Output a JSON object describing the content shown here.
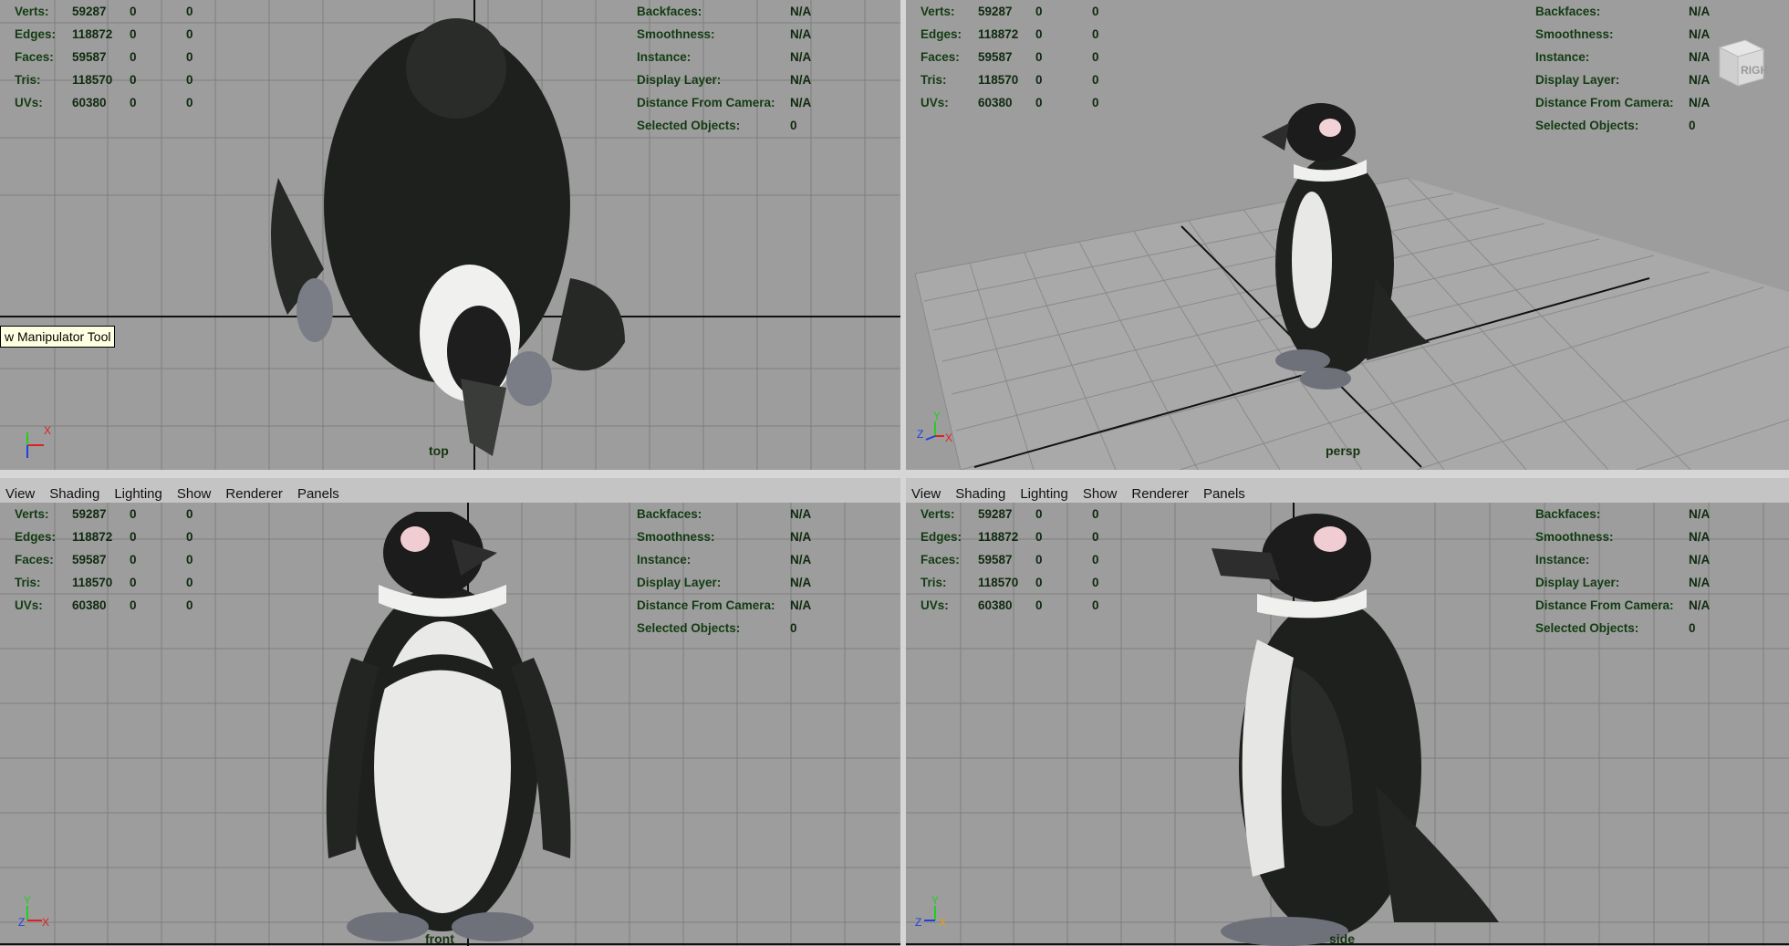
{
  "hud": {
    "left_labels": [
      "Verts:",
      "Edges:",
      "Faces:",
      "Tris:",
      "UVs:"
    ],
    "left_values": [
      [
        "59287",
        "0",
        "0"
      ],
      [
        "118872",
        "0",
        "0"
      ],
      [
        "59587",
        "0",
        "0"
      ],
      [
        "118570",
        "0",
        "0"
      ],
      [
        "60380",
        "0",
        "0"
      ]
    ],
    "right_labels": [
      "Backfaces:",
      "Smoothness:",
      "Instance:",
      "Display Layer:",
      "Distance From Camera:",
      "Selected Objects:"
    ],
    "right_values": [
      "N/A",
      "N/A",
      "N/A",
      "N/A",
      "N/A",
      "0"
    ]
  },
  "panel_menu": [
    "View",
    "Shading",
    "Lighting",
    "Show",
    "Renderer",
    "Panels"
  ],
  "cameras": {
    "top": "top",
    "persp": "persp",
    "front": "front",
    "side": "side"
  },
  "tooltip": "w Manipulator Tool",
  "viewcube_label": "RIGHT",
  "axis_letters": {
    "x": "X",
    "y": "Y",
    "z": "Z"
  },
  "colors": {
    "viewport_bg": "#9d9d9d",
    "hud_text": "#123c12",
    "grid": "#7e7e7e",
    "axis_x": "#e02020",
    "axis_y": "#20d020",
    "axis_z": "#2040e0"
  }
}
